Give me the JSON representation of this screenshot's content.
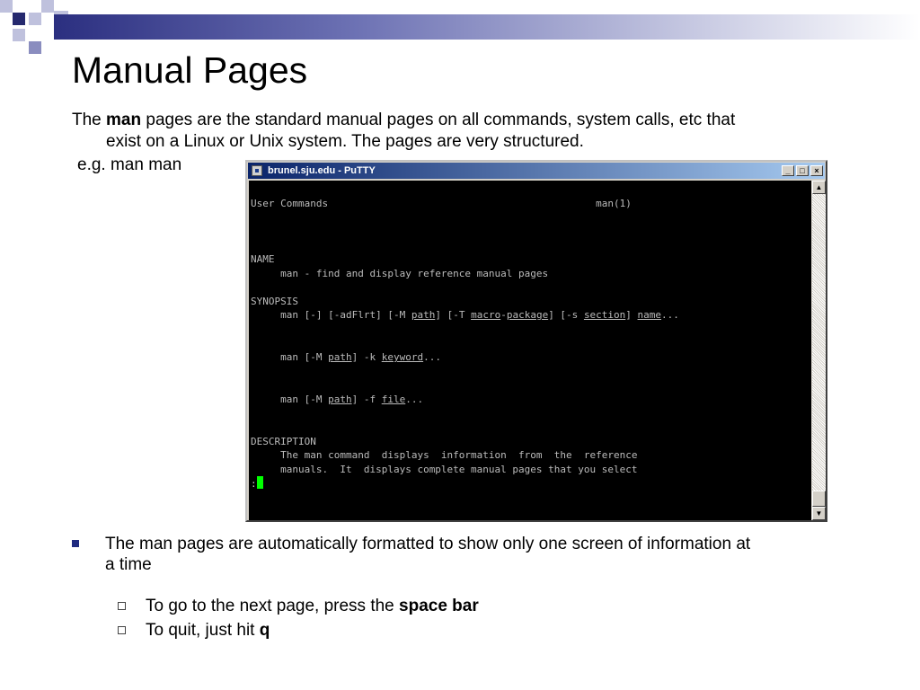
{
  "slide": {
    "title": "Manual Pages",
    "intro": {
      "prefix": "The ",
      "bold": "man",
      "rest_line1": " pages are the standard manual pages on all commands, system calls, etc that",
      "line2": "exist on a Linux or Unix system. The pages are very structured."
    },
    "example": "e.g. man man",
    "bullet": {
      "line1": "The man pages are automatically formatted to show only one screen of information at",
      "line2": "a time"
    },
    "subbullets": [
      {
        "text": "To go to the next page, press the ",
        "bold": "space bar"
      },
      {
        "text": "To quit, just hit ",
        "bold": "q"
      }
    ]
  },
  "putty": {
    "title": "brunel.sju.edu - PuTTY",
    "buttons": {
      "minimize": "_",
      "maximize": "□",
      "close": "×"
    },
    "term": {
      "header_left": "User Commands",
      "header_right": "man(1)",
      "name_heading": "NAME",
      "name_line": "man - find and display reference manual pages",
      "synopsis_heading": "SYNOPSIS",
      "syn1_a": "man [-] [-adFlrt] [-M ",
      "syn1_path": "path",
      "syn1_b": "] [-T ",
      "syn1_macro": "macro",
      "syn1_dash": "-",
      "syn1_package": "package",
      "syn1_c": "] [-s ",
      "syn1_section": "section",
      "syn1_d": "] ",
      "syn1_name": "name",
      "syn1_e": "...",
      "syn2_a": "man [-M ",
      "syn2_path": "path",
      "syn2_b": "] -k ",
      "syn2_keyword": "keyword",
      "syn2_c": "...",
      "syn3_a": "man [-M ",
      "syn3_path": "path",
      "syn3_b": "] -f ",
      "syn3_file": "file",
      "syn3_c": "...",
      "description_heading": "DESCRIPTION",
      "desc1": "The man command  displays  information  from  the  reference",
      "desc2": "manuals.  It  displays complete manual pages that you select",
      "prompt": ":"
    },
    "scrollbar": {
      "up": "▲",
      "down": "▼"
    }
  }
}
